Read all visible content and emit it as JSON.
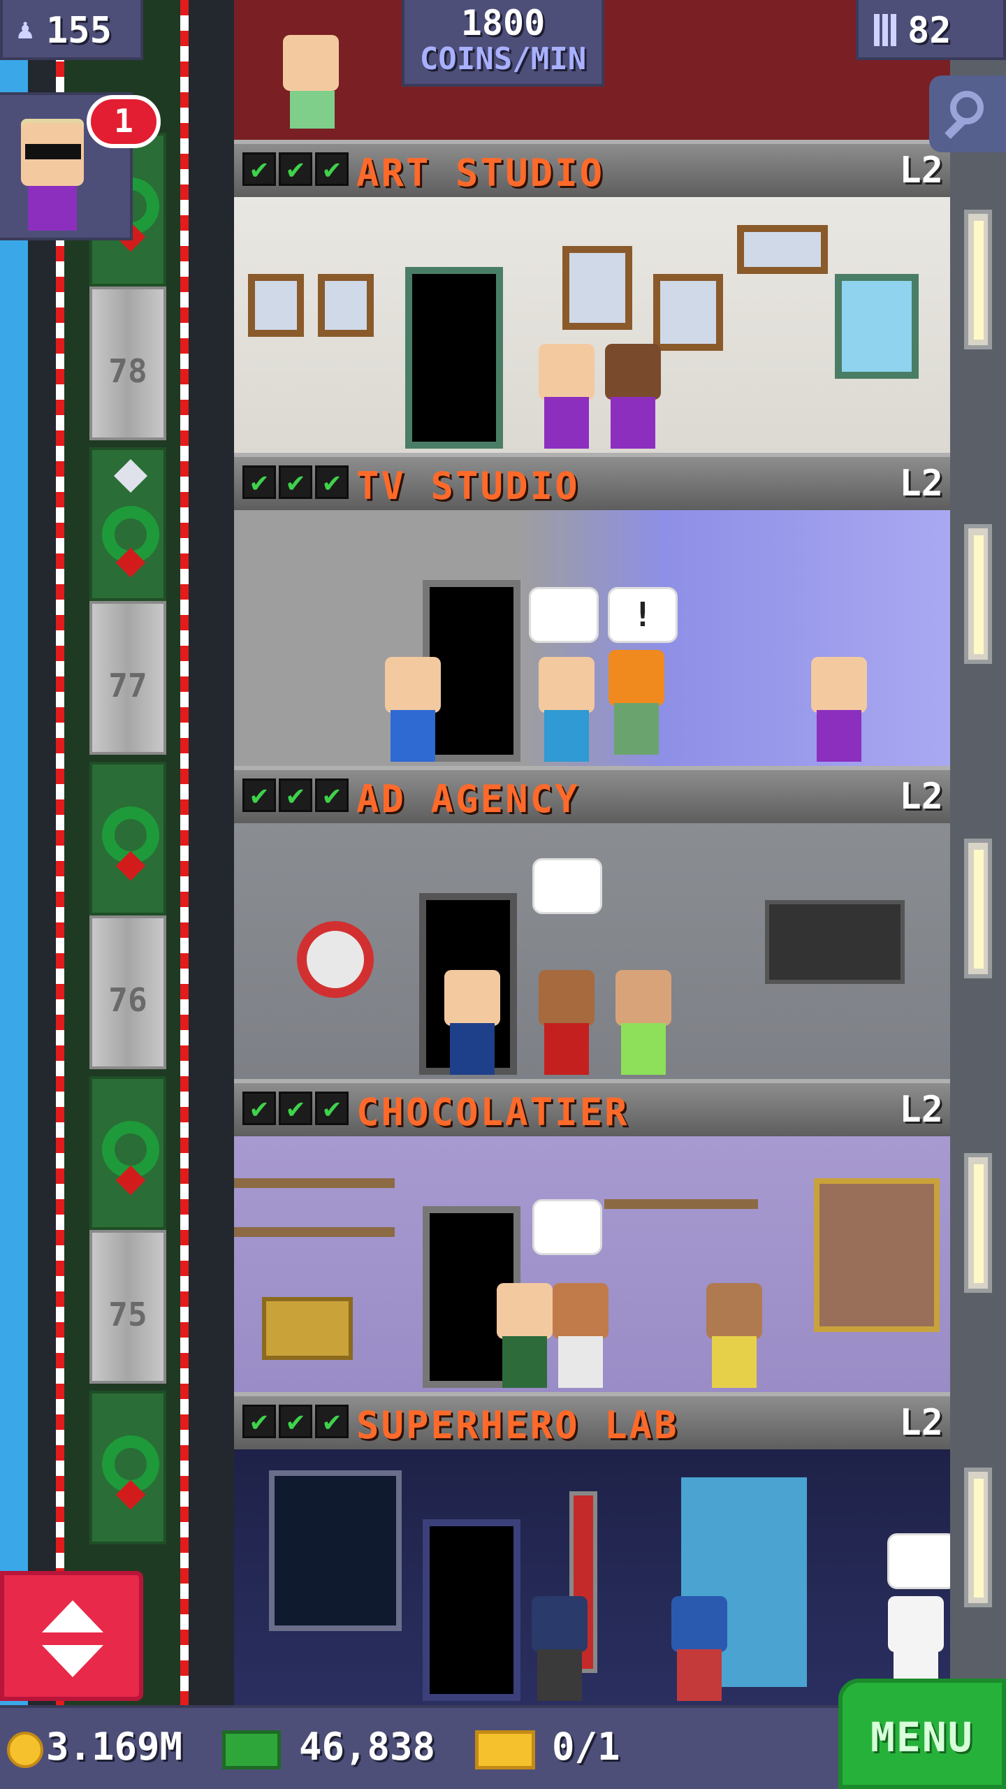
{
  "hud": {
    "population": "155",
    "coins_per_min_value": "1800",
    "coins_per_min_label": "COINS/MIN",
    "floor_count": "82",
    "visitor_badge": "1"
  },
  "shaft": {
    "floor_numbers": [
      "78",
      "77",
      "76",
      "75"
    ]
  },
  "floors": [
    {
      "name": "ART STUDIO",
      "level": "L2",
      "checks": [
        "✔",
        "✔",
        "✔"
      ]
    },
    {
      "name": "TV STUDIO",
      "level": "L2",
      "checks": [
        "✔",
        "✔",
        "✔"
      ],
      "bubbles": [
        "!"
      ]
    },
    {
      "name": "AD AGENCY",
      "level": "L2",
      "checks": [
        "✔",
        "✔",
        "✔"
      ]
    },
    {
      "name": "CHOCOLATIER",
      "level": "L2",
      "checks": [
        "✔",
        "✔",
        "✔"
      ]
    },
    {
      "name": "SUPERHERO LAB",
      "level": "L2",
      "checks": [
        "✔",
        "✔",
        "✔"
      ]
    }
  ],
  "bottom_bar": {
    "coins": "3.169M",
    "tower_bux": "46,838",
    "tickets": "0/1",
    "menu_label": "MENU"
  },
  "icons": {
    "population": "person-icon",
    "floors": "building-icon",
    "zoom": "magnifier-icon",
    "coin": "coin-icon",
    "bux": "bux-icon",
    "ticket": "ticket-icon",
    "elevator": "elevator-arrows-icon"
  },
  "colors": {
    "hud_bg": "#4d4f79",
    "floor_name": "#ff6a2a",
    "menu_green": "#26b23a",
    "elevator_red": "#e8294a",
    "check_green": "#3fd24b"
  }
}
